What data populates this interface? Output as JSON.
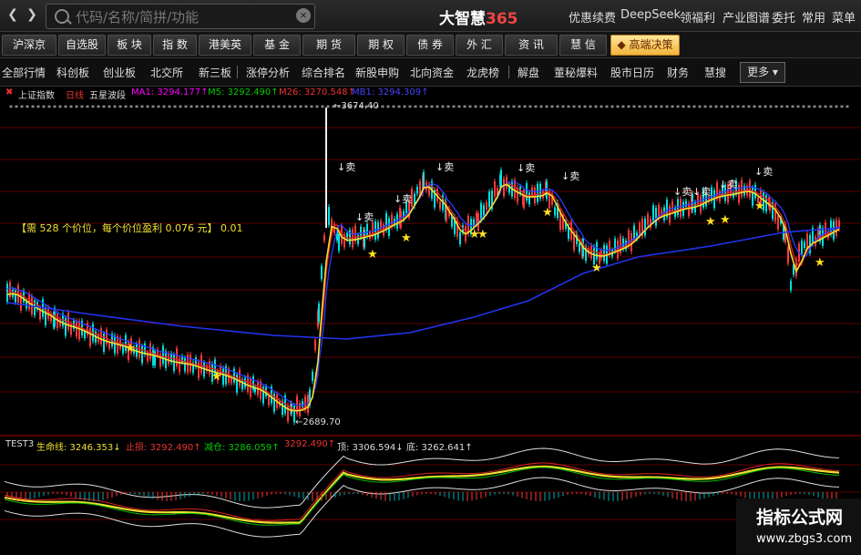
{
  "topbar": {
    "search_placeholder": "代码/名称/简拼/功能",
    "brand_text": "大智慧",
    "brand_num": "365",
    "menu": [
      "优惠续费",
      "DeepSeek",
      "领福利",
      "产业图谱",
      "委托",
      "常用",
      "菜单"
    ]
  },
  "tabs": [
    "沪深京",
    "自选股",
    "板 块",
    "指 数",
    "港美英",
    "基 金",
    "期 货",
    "期 权",
    "债 券",
    "外 汇",
    "资 讯",
    "慧 信",
    "高端决策"
  ],
  "links": [
    "全部行情",
    "科创板",
    "创业板",
    "北交所",
    "新三板",
    "涨停分析",
    "综合排名",
    "新股申购",
    "北向资金",
    "龙虎榜",
    "解盘",
    "董秘爆料",
    "股市日历",
    "财务",
    "慧搜"
  ],
  "more_label": "更多",
  "chart_header": {
    "title": "上证指数",
    "period": "日线",
    "name": "五星波段",
    "ma1": "MA1: 3294.177↑",
    "m5": "M5: 3292.490↑",
    "m26": "M26: 3270.548↑",
    "mb1": "MB1: 3294.309↑"
  },
  "annotations": {
    "high": "3674.40",
    "low": "2689.70",
    "info": "【需  528  个价位，每个价位盈利  0.076 元】 0.01",
    "sell": "卖"
  },
  "sub_header": {
    "name": "TEST3",
    "life": "生命线: 3246.353↓",
    "stop": "止损: 3292.490↑",
    "reduce": "减仓: 3286.059↑",
    "val2": "3292.490↑",
    "top": "顶: 3306.594↓",
    "bottom": "底: 3262.641↑"
  },
  "watermark": {
    "title": "指标公式网",
    "url": "www.zbgs3.com"
  },
  "colors": {
    "up": "#ff3b3b",
    "down": "#00e0e0",
    "yellow": "#f0e030",
    "blue": "#2233ee",
    "red_line": "#e02020",
    "white": "#ffffff"
  },
  "chart_data": {
    "type": "line",
    "title": "上证指数 日线",
    "main_high": 3674.4,
    "main_low": 2689.7,
    "last_values": {
      "MA1": 3294.177,
      "M5": 3292.49,
      "M26": 3270.548,
      "MB1": 3294.309
    },
    "sub_last_values": {
      "生命线": 3246.353,
      "止损": 3292.49,
      "减仓": 3286.059,
      "顶": 3306.594,
      "底": 3262.641
    }
  }
}
